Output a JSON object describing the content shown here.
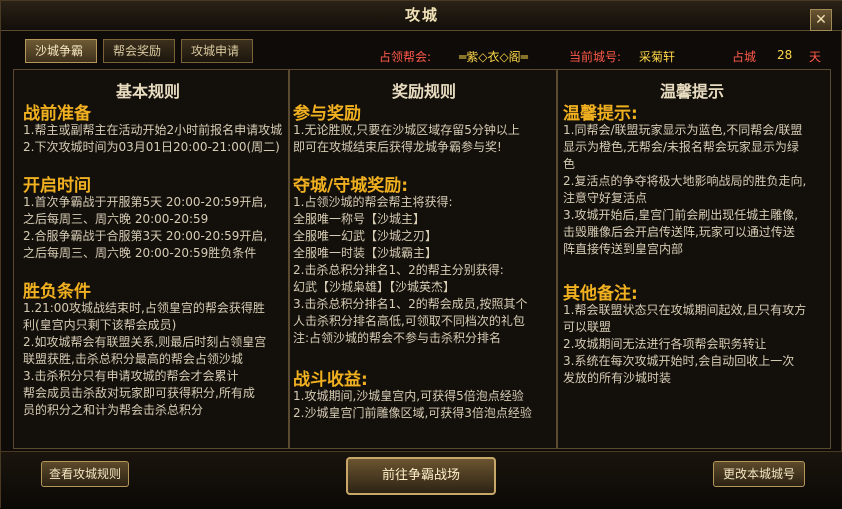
{
  "window": {
    "title": "攻城",
    "close_icon": "close-icon"
  },
  "tabs": [
    {
      "label": "沙城争霸"
    },
    {
      "label": "帮会奖励"
    },
    {
      "label": "攻城申请"
    }
  ],
  "info": {
    "guild_label": "占领帮会:",
    "guild_value": "═紫◇衣◇阁═",
    "city_label": "当前城号:",
    "city_value": "采菊轩",
    "days_label": "占城",
    "days_value": "28",
    "days_unit": "天"
  },
  "col1": {
    "title": "基本规则",
    "s1": "战前准备",
    "s1_lines": [
      "1.帮主或副帮主在活动开始2小时前报名申请攻城",
      "2.下次攻城时间为03月01日20:00-21:00(周二)"
    ],
    "s2": "开启时间",
    "s2_lines": [
      "1.首次争霸战于开服第5天 20:00-20:59开启,",
      "  之后每周三、周六晚 20:00-20:59",
      "2.合服争霸战于合服第3天 20:00-20:59开启,",
      "  之后每周三、周六晚 20:00-20:59胜负条件"
    ],
    "s3": "胜负条件",
    "s3_lines": [
      "1.21:00攻城战结束时,占领皇宫的帮会获得胜",
      "  利(皇宫内只剩下该帮会成员)",
      "2.如攻城帮会有联盟关系,则最后时刻占领皇宫",
      "  联盟获胜,击杀总积分最高的帮会占领沙城",
      "3.击杀积分只有申请攻城的帮会才会累计",
      "  帮会成员击杀敌对玩家即可获得积分,所有成",
      "  员的积分之和计为帮会击杀总积分"
    ]
  },
  "col2": {
    "title": "奖励规则",
    "s1": "参与奖励",
    "s1_lines": [
      "1.无论胜败,只要在沙城区域存留5分钟以上",
      "  即可在攻城结束后获得龙城争霸参与奖!"
    ],
    "s2": "夺城/守城奖励:",
    "s2_lines": [
      "1.占领沙城的帮会帮主将获得:",
      "  全服唯一称号【沙城主】",
      "  全服唯一幻武【沙城之刃】",
      "  全服唯一时装【沙城霸主】",
      "2.击杀总积分排名1、2的帮主分别获得:",
      "  幻武【沙城枭雄】【沙城英杰】",
      "3.击杀总积分排名1、2的帮会成员,按照其个",
      "  人击杀积分排名高低,可领取不同档次的礼包",
      "  注:占领沙城的帮会不参与击杀积分排名"
    ],
    "s3": "战斗收益:",
    "s3_lines": [
      "1.攻城期间,沙城皇宫内,可获得5倍泡点经验",
      "2.沙城皇宫门前雕像区域,可获得3倍泡点经验"
    ]
  },
  "col3": {
    "title": "温馨提示",
    "s1": "温馨提示:",
    "s1_lines": [
      "1.同帮会/联盟玩家显示为蓝色,不同帮会/联盟",
      "  显示为橙色,无帮会/未报名帮会玩家显示为绿",
      "  色",
      "2.复活点的争夺将极大地影响战局的胜负走向,",
      "  注意守好复活点",
      "3.攻城开始后,皇宫门前会刷出现任城主雕像,",
      "  击毁雕像后会开启传送阵,玩家可以通过传送",
      "  阵直接传送到皇宫内部"
    ],
    "s2": "其他备注:",
    "s2_lines": [
      "1.帮会联盟状态只在攻城期间起效,且只有攻方",
      "  可以联盟",
      "2.攻城期间无法进行各项帮会职务转让",
      "3.系统在每次攻城开始时,会自动回收上一次",
      "  发放的所有沙城时装"
    ]
  },
  "buttons": {
    "view_rules": "查看攻城规则",
    "go_battle": "前往争霸战场",
    "rename_city": "更改本城城号"
  }
}
